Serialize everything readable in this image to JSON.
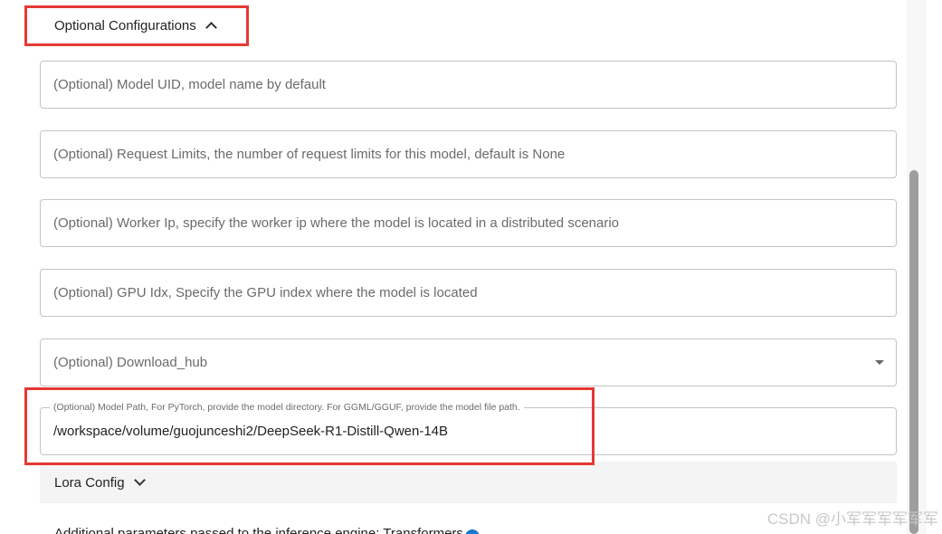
{
  "section": {
    "title": "Optional Configurations",
    "expanded": true
  },
  "fields": {
    "model_uid": {
      "placeholder": "(Optional) Model UID, model name by default"
    },
    "request_limits": {
      "placeholder": "(Optional) Request Limits, the number of request limits for this model, default is None"
    },
    "worker_ip": {
      "placeholder": "(Optional) Worker Ip, specify the worker ip where the model is located in a distributed scenario"
    },
    "gpu_idx": {
      "placeholder": "(Optional) GPU Idx, Specify the GPU index where the model is located"
    },
    "download_hub": {
      "placeholder": "(Optional) Download_hub"
    },
    "model_path": {
      "label": "(Optional) Model Path, For PyTorch, provide the model directory. For GGML/GGUF, provide the model file path.",
      "value": "/workspace/volume/guojunceshi2/DeepSeek-R1-Distill-Qwen-14B"
    }
  },
  "lora": {
    "title": "Lora Config",
    "expanded": false
  },
  "bottom_partial_text": "Additional parameters passed to the inference engine: Transformers",
  "watermark": "CSDN @小军军军军军军",
  "colors": {
    "annotation_red": "#e53935",
    "info_blue": "#1976d2",
    "scrollbar": "#9e9e9e"
  },
  "icons": {
    "section_toggle": "chevron-up-icon",
    "lora_toggle": "chevron-down-icon",
    "select_arrow": "caret-down-icon",
    "info": "info-icon"
  }
}
